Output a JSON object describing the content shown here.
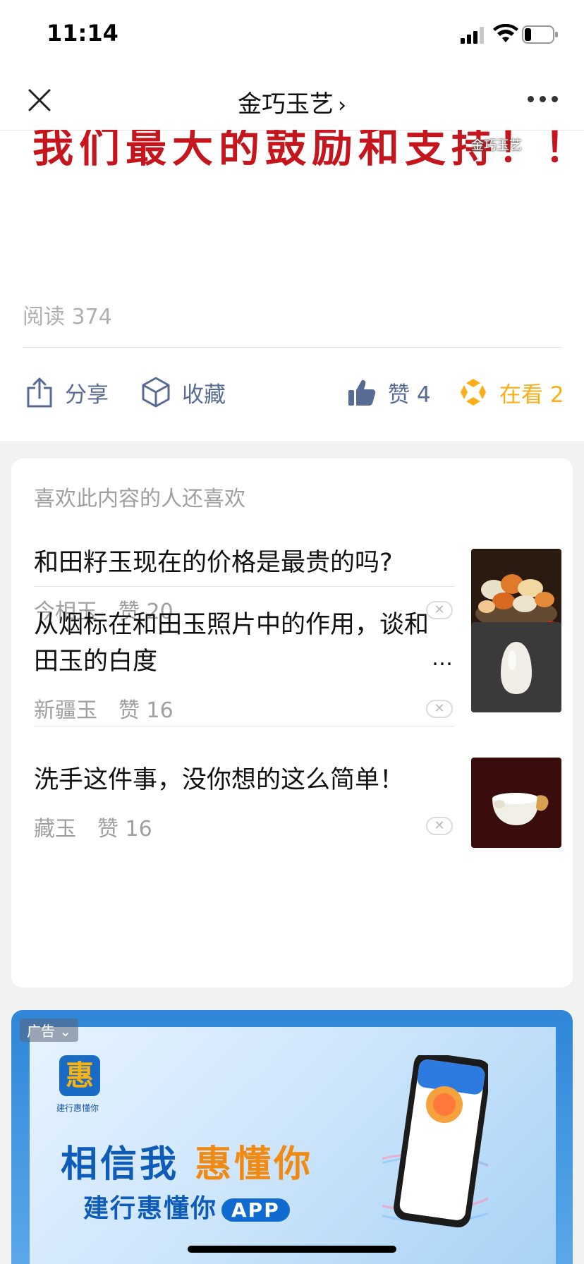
{
  "status_bar": {
    "time": "11:14"
  },
  "nav": {
    "title": "金巧玉艺",
    "chevron": "›"
  },
  "article": {
    "banner_text": "我们最大的鼓励和支持！！",
    "watermark": "金巧玉艺",
    "read_label": "阅读 374"
  },
  "actions": {
    "share": "分享",
    "favorite": "收藏",
    "like": "赞 4",
    "watching": "在看 2"
  },
  "recommend": {
    "header": "喜欢此内容的人还喜欢",
    "items": [
      {
        "title": "和田籽玉现在的价格是最贵的吗?",
        "source": "今相玉",
        "likes": "赞 20"
      },
      {
        "title": "从烟标在和田玉照片中的作用，谈和田玉的白度",
        "source": "新疆玉",
        "likes": "赞 16"
      },
      {
        "title": "洗手这件事，没你想的这么简单！",
        "source": "藏玉",
        "likes": "赞 16"
      }
    ],
    "dismiss": "✕",
    "ellipsis": "…"
  },
  "ad": {
    "label": "广告",
    "logo_char": "惠",
    "logo_text": "建行惠懂你",
    "slogan_a": "相信我",
    "slogan_b": "惠懂你",
    "sub": "建行惠懂你",
    "app": "APP"
  },
  "colors": {
    "link": "#576b95",
    "watching": "#fbae17",
    "banner_red": "#c4161c"
  }
}
